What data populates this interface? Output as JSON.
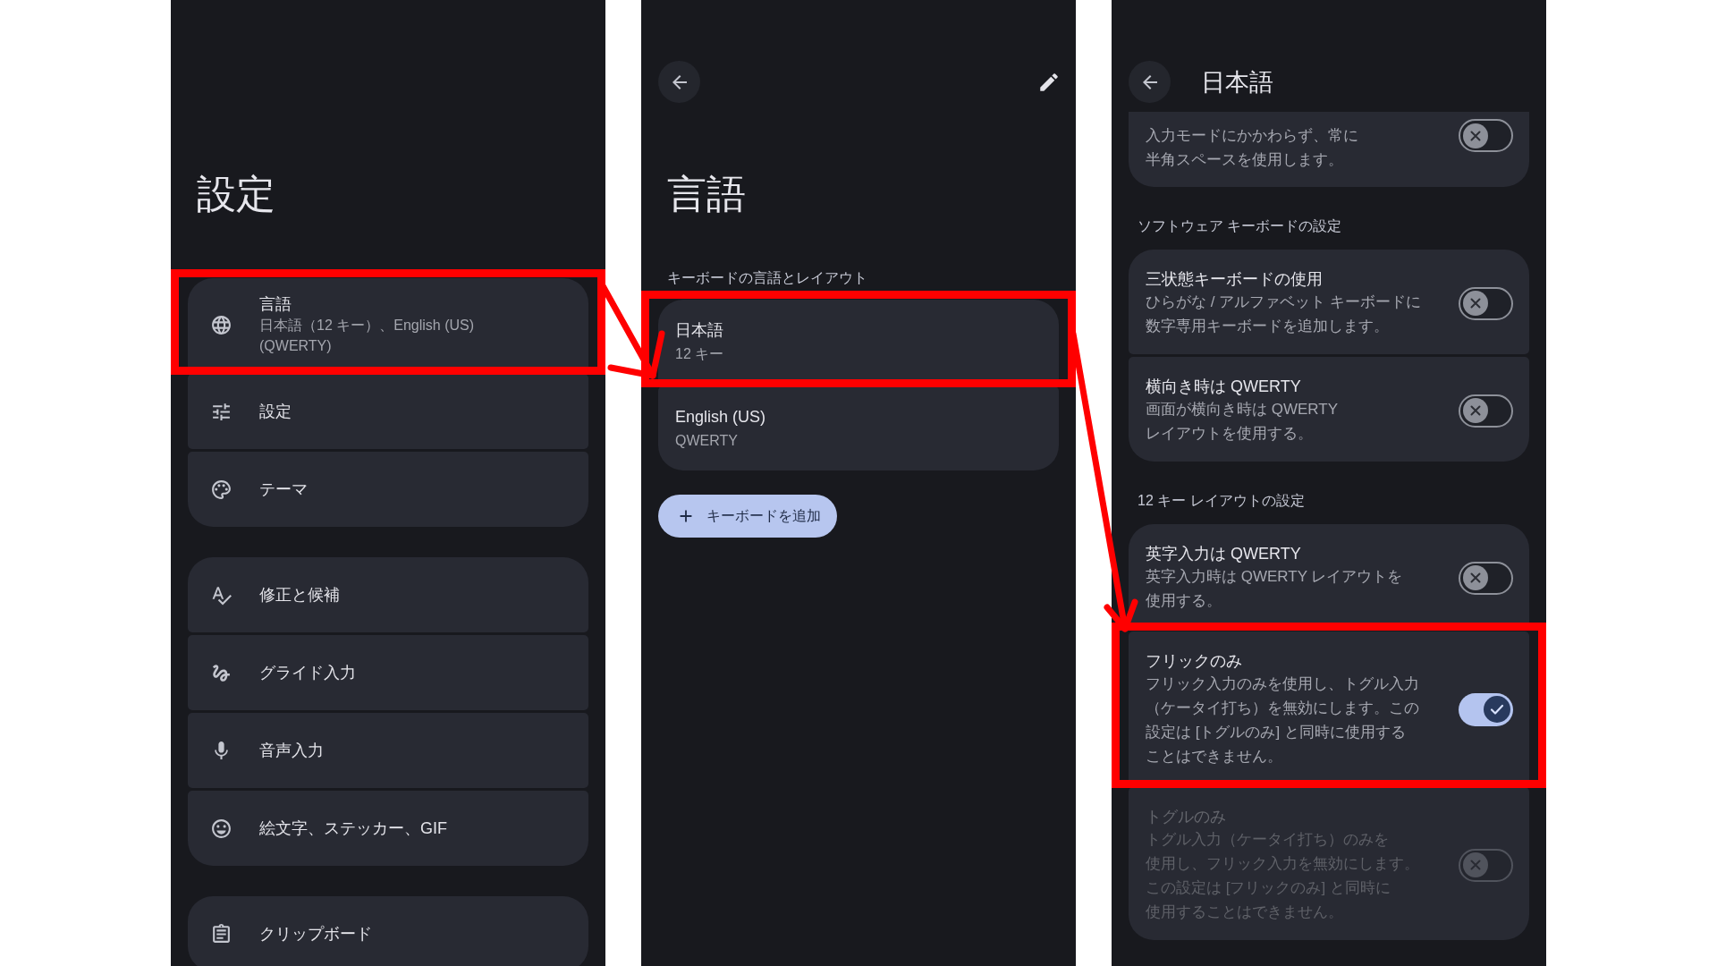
{
  "settings_screen": {
    "title": "設定",
    "groups": [
      {
        "items": [
          {
            "title": "言語",
            "subtitle": "日本語（12 キー）、English (US)\n(QWERTY)",
            "highlighted": true
          },
          {
            "title": "設定",
            "highlighted": false
          },
          {
            "title": "テーマ",
            "highlighted": false
          }
        ]
      },
      {
        "items": [
          {
            "title": "修正と候補",
            "highlighted": false
          },
          {
            "title": "グライド入力",
            "highlighted": false
          },
          {
            "title": "音声入力",
            "highlighted": false
          },
          {
            "title": "絵文字、ステッカー、GIF",
            "highlighted": false
          }
        ]
      },
      {
        "items": [
          {
            "title": "クリップボード",
            "highlighted": false
          }
        ]
      }
    ]
  },
  "language_screen": {
    "title": "言語",
    "section_heading": "キーボードの言語とレイアウト",
    "languages": [
      {
        "name": "日本語",
        "layout": "12 キー",
        "highlighted": true
      },
      {
        "name": "English (US)",
        "layout": "QWERTY",
        "highlighted": false
      }
    ],
    "add_button": "キーボードを追加"
  },
  "japanese_screen": {
    "title": "日本語",
    "sections": [
      {
        "items": [
          {
            "description": "入力モードにかかわらず、常に半角スペースを使用します。",
            "on": false,
            "disabled": false,
            "highlighted": false
          }
        ]
      },
      {
        "heading": "ソフトウェア キーボードの設定",
        "items": [
          {
            "title": "三状態キーボードの使用",
            "description": "ひらがな / アルファベット キーボードに数字専用キーボードを追加します。",
            "on": false,
            "disabled": false,
            "highlighted": false
          },
          {
            "title": "横向き時は QWERTY",
            "description": "画面が横向き時は QWERTY レイアウトを使用する。",
            "on": false,
            "disabled": false,
            "highlighted": false
          }
        ]
      },
      {
        "heading": "12 キー レイアウトの設定",
        "items": [
          {
            "title": "英字入力は QWERTY",
            "description": "英字入力時は QWERTY レイアウトを使用する。",
            "on": false,
            "disabled": false,
            "highlighted": false
          },
          {
            "title": "フリックのみ",
            "description": "フリック入力のみを使用し、トグル入力（ケータイ打ち）を無効にします。この設定は [トグルのみ] と同時に使用することはできません。",
            "on": true,
            "disabled": false,
            "highlighted": true
          },
          {
            "title": "トグルのみ",
            "description": "トグル入力（ケータイ打ち）のみを使用し、フリック入力を無効にします。この設定は [フリックのみ] と同時に使用することはできません。",
            "on": false,
            "disabled": true,
            "highlighted": false
          }
        ]
      }
    ]
  }
}
